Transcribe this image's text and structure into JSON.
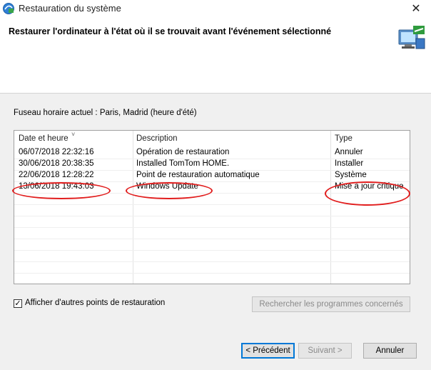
{
  "window": {
    "title": "Restauration du système",
    "close_glyph": "✕",
    "app_icon": "system-restore-icon"
  },
  "header": {
    "heading": "Restaurer l'ordinateur à l'état où il se trouvait avant l'événement sélectionné",
    "icon": "computer-restore-icon"
  },
  "timezone_text": "Fuseau horaire actuel : Paris, Madrid (heure d'été)",
  "list": {
    "columns": {
      "date": "Date et heure",
      "description": "Description",
      "type": "Type"
    },
    "rows": [
      {
        "date": "06/07/2018 22:32:16",
        "description": "Opération de restauration",
        "type": "Annuler"
      },
      {
        "date": "30/06/2018 20:38:35",
        "description": "Installed TomTom HOME.",
        "type": "Installer"
      },
      {
        "date": "22/06/2018 12:28:22",
        "description": "Point de restauration automatique",
        "type": "Système"
      },
      {
        "date": "13/06/2018 19:43:03",
        "description": "Windows Update",
        "type": "Mise à jour critique"
      }
    ],
    "annotation_color": "#e11d1d"
  },
  "show_more": {
    "label": "Afficher d'autres points de restauration",
    "checked": true,
    "check_glyph": "✓"
  },
  "buttons": {
    "scan": "Rechercher les programmes concernés",
    "back": "< Précédent",
    "next": "Suivant >",
    "cancel": "Annuler"
  }
}
